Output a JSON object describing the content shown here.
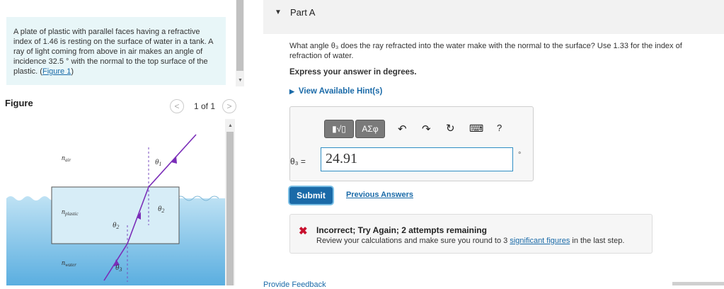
{
  "problem": {
    "text": "A plate of plastic with parallel faces having a refractive index of 1.46 is resting on the surface of water in a tank. A ray of light coming from above in air makes an angle of incidence 32.5 ° with the normal to the top surface of the plastic. (",
    "link": "Figure 1",
    "close": ")"
  },
  "figure": {
    "title": "Figure",
    "pager": "1 of 1",
    "labels": {
      "n_air": "n",
      "n_air_sub": "air",
      "n_plastic": "n",
      "n_plastic_sub": "plastic",
      "n_water": "n",
      "n_water_sub": "water",
      "theta1": "θ",
      "theta1_sub": "1",
      "theta2a": "θ",
      "theta2a_sub": "2",
      "theta2b": "θ",
      "theta2b_sub": "2",
      "theta3": "θ",
      "theta3_sub": "3"
    },
    "colors": {
      "ray": "#7a2db8",
      "water": "#5aaee0",
      "plastic": "#d7edf7",
      "normal": "#7a4fbf"
    }
  },
  "part": {
    "title": "Part A",
    "question": "What angle θ₃ does the ray refracted into the water make with the normal to the surface? Use 1.33 for the index of refraction of water.",
    "express": "Express your answer in degrees.",
    "hints": "View Available Hint(s)"
  },
  "answer": {
    "toolbar": {
      "templates_label": "▮√▯",
      "symbols_label": "ΑΣφ",
      "undo_icon": "↶",
      "redo_icon": "↷",
      "reset_icon": "↻",
      "keyboard_icon": "⌨",
      "help_label": "?"
    },
    "variable_label": "θ₃ =",
    "value": "24.91",
    "unit": "°"
  },
  "actions": {
    "submit": "Submit",
    "previous_answers": "Previous Answers"
  },
  "feedback": {
    "icon": "✖",
    "title": "Incorrect; Try Again; 2 attempts remaining",
    "message_prefix": "Review your calculations and make sure you round to 3 ",
    "message_link": "significant figures",
    "message_suffix": " in the last step."
  },
  "footer": {
    "provide_feedback": "Provide Feedback"
  }
}
